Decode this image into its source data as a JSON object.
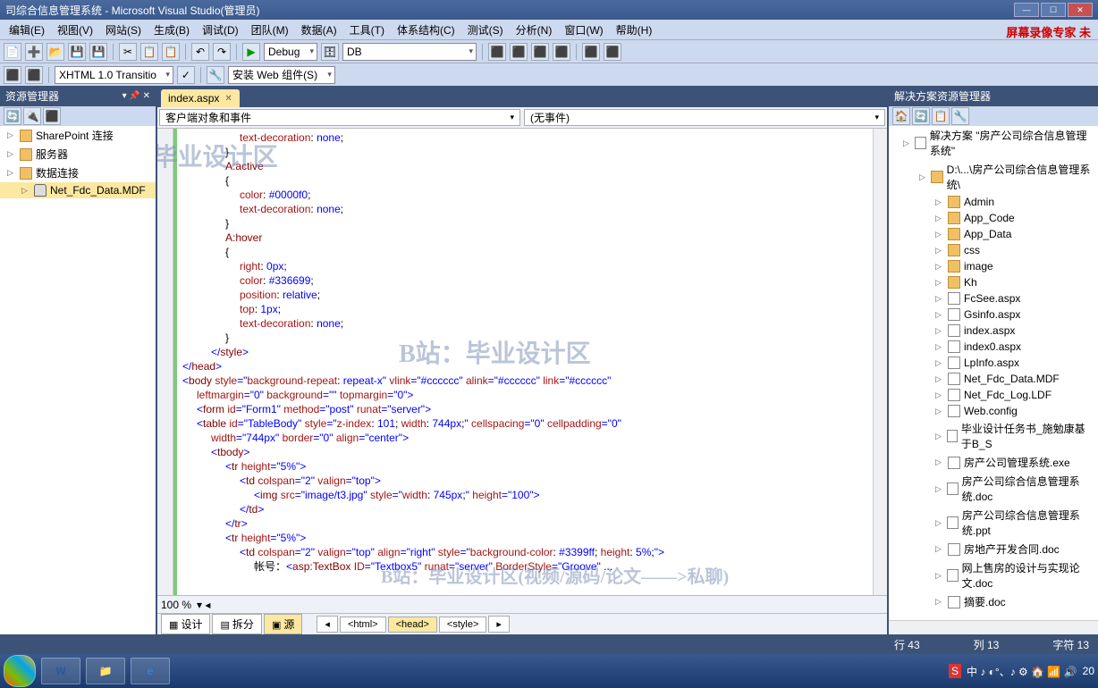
{
  "title": "司综合信息管理系统 - Microsoft Visual Studio(管理员)",
  "watermark_top": "屏幕录像专家 未",
  "menus": [
    "编辑(E)",
    "视图(V)",
    "网站(S)",
    "生成(B)",
    "调试(D)",
    "团队(M)",
    "数据(A)",
    "工具(T)",
    "体系结构(C)",
    "测试(S)",
    "分析(N)",
    "窗口(W)",
    "帮助(H)"
  ],
  "toolbar1": {
    "config": "Debug",
    "db": "DB"
  },
  "toolbar2": {
    "doctype": "XHTML 1.0 Transitio",
    "install": "安装 Web 组件(S)"
  },
  "left_panel": {
    "title": "资源管理器",
    "items": [
      "SharePoint 连接",
      "服务器",
      "数据连接"
    ],
    "child": "Net_Fdc_Data.MDF"
  },
  "tab": "index.aspx",
  "dd_left": "客户端对象和事件",
  "dd_right": "(无事件)",
  "code_lines": [
    {
      "indent": 16,
      "parts": [
        {
          "c": "c-r",
          "t": "text-decoration"
        },
        {
          "t": ": "
        },
        {
          "c": "c-b",
          "t": "none"
        },
        {
          "t": ";"
        }
      ]
    },
    {
      "indent": 12,
      "parts": [
        {
          "t": "}"
        }
      ]
    },
    {
      "indent": 12,
      "parts": [
        {
          "c": "c-m",
          "t": "A:active"
        }
      ]
    },
    {
      "indent": 12,
      "parts": [
        {
          "t": "{"
        }
      ]
    },
    {
      "indent": 16,
      "parts": [
        {
          "c": "c-r",
          "t": "color"
        },
        {
          "t": ": "
        },
        {
          "c": "c-b",
          "t": "#0000f0"
        },
        {
          "t": ";"
        }
      ]
    },
    {
      "indent": 16,
      "parts": [
        {
          "c": "c-r",
          "t": "text-decoration"
        },
        {
          "t": ": "
        },
        {
          "c": "c-b",
          "t": "none"
        },
        {
          "t": ";"
        }
      ]
    },
    {
      "indent": 12,
      "parts": [
        {
          "t": "}"
        }
      ]
    },
    {
      "indent": 12,
      "parts": [
        {
          "c": "c-m",
          "t": "A:hover"
        }
      ]
    },
    {
      "indent": 12,
      "parts": [
        {
          "t": "{"
        }
      ]
    },
    {
      "indent": 16,
      "parts": [
        {
          "c": "c-r",
          "t": "right"
        },
        {
          "t": ": "
        },
        {
          "c": "c-b",
          "t": "0px"
        },
        {
          "t": ";"
        }
      ]
    },
    {
      "indent": 16,
      "parts": [
        {
          "c": "c-r",
          "t": "color"
        },
        {
          "t": ": "
        },
        {
          "c": "c-b",
          "t": "#336699"
        },
        {
          "t": ";"
        }
      ]
    },
    {
      "indent": 16,
      "parts": [
        {
          "c": "c-r",
          "t": "position"
        },
        {
          "t": ": "
        },
        {
          "c": "c-b",
          "t": "relative"
        },
        {
          "t": ";"
        }
      ]
    },
    {
      "indent": 16,
      "parts": [
        {
          "c": "c-r",
          "t": "top"
        },
        {
          "t": ": "
        },
        {
          "c": "c-b",
          "t": "1px"
        },
        {
          "t": ";"
        }
      ]
    },
    {
      "indent": 16,
      "parts": [
        {
          "c": "c-r",
          "t": "text-decoration"
        },
        {
          "t": ": "
        },
        {
          "c": "c-b",
          "t": "none"
        },
        {
          "t": ";"
        }
      ]
    },
    {
      "indent": 12,
      "parts": [
        {
          "t": "}"
        }
      ]
    },
    {
      "indent": 8,
      "parts": [
        {
          "c": "c-b",
          "t": "</"
        },
        {
          "c": "c-m",
          "t": "style"
        },
        {
          "c": "c-b",
          "t": ">"
        }
      ]
    },
    {
      "indent": 0,
      "parts": [
        {
          "c": "c-b",
          "t": "</"
        },
        {
          "c": "c-m",
          "t": "head"
        },
        {
          "c": "c-b",
          "t": ">"
        }
      ]
    },
    {
      "indent": 0,
      "parts": [
        {
          "c": "c-b",
          "t": "<"
        },
        {
          "c": "c-m",
          "t": "body"
        },
        {
          "t": " "
        },
        {
          "c": "c-r",
          "t": "style"
        },
        {
          "c": "c-b",
          "t": "=\""
        },
        {
          "c": "c-r",
          "t": "background-repeat"
        },
        {
          "t": ": "
        },
        {
          "c": "c-b",
          "t": "repeat-x\""
        },
        {
          "t": " "
        },
        {
          "c": "c-r",
          "t": "vlink"
        },
        {
          "c": "c-b",
          "t": "=\"#cccccc\""
        },
        {
          "t": " "
        },
        {
          "c": "c-r",
          "t": "alink"
        },
        {
          "c": "c-b",
          "t": "=\"#cccccc\""
        },
        {
          "t": " "
        },
        {
          "c": "c-r",
          "t": "link"
        },
        {
          "c": "c-b",
          "t": "=\"#cccccc\""
        }
      ]
    },
    {
      "indent": 4,
      "parts": [
        {
          "c": "c-r",
          "t": "leftmargin"
        },
        {
          "c": "c-b",
          "t": "=\"0\""
        },
        {
          "t": " "
        },
        {
          "c": "c-r",
          "t": "background"
        },
        {
          "c": "c-b",
          "t": "=\"\""
        },
        {
          "t": " "
        },
        {
          "c": "c-r",
          "t": "topmargin"
        },
        {
          "c": "c-b",
          "t": "=\"0\">"
        }
      ]
    },
    {
      "indent": 4,
      "parts": [
        {
          "c": "c-b",
          "t": "<"
        },
        {
          "c": "c-m",
          "t": "form"
        },
        {
          "t": " "
        },
        {
          "c": "c-r",
          "t": "id"
        },
        {
          "c": "c-b",
          "t": "=\"Form1\""
        },
        {
          "t": " "
        },
        {
          "c": "c-r",
          "t": "method"
        },
        {
          "c": "c-b",
          "t": "=\"post\""
        },
        {
          "t": " "
        },
        {
          "c": "c-r",
          "t": "runat"
        },
        {
          "c": "c-b",
          "t": "=\"server\">"
        }
      ]
    },
    {
      "indent": 4,
      "parts": [
        {
          "c": "c-b",
          "t": "<"
        },
        {
          "c": "c-m",
          "t": "table"
        },
        {
          "t": " "
        },
        {
          "c": "c-r",
          "t": "id"
        },
        {
          "c": "c-b",
          "t": "=\"TableBody\""
        },
        {
          "t": " "
        },
        {
          "c": "c-r",
          "t": "style"
        },
        {
          "c": "c-b",
          "t": "=\""
        },
        {
          "c": "c-r",
          "t": "z-index"
        },
        {
          "t": ": "
        },
        {
          "c": "c-b",
          "t": "101"
        },
        {
          "t": "; "
        },
        {
          "c": "c-r",
          "t": "width"
        },
        {
          "t": ": "
        },
        {
          "c": "c-b",
          "t": "744px"
        },
        {
          "t": ";"
        },
        {
          "c": "c-b",
          "t": "\""
        },
        {
          "t": " "
        },
        {
          "c": "c-r",
          "t": "cellspacing"
        },
        {
          "c": "c-b",
          "t": "=\"0\""
        },
        {
          "t": " "
        },
        {
          "c": "c-r",
          "t": "cellpadding"
        },
        {
          "c": "c-b",
          "t": "=\"0\""
        }
      ]
    },
    {
      "indent": 8,
      "parts": [
        {
          "c": "c-r",
          "t": "width"
        },
        {
          "c": "c-b",
          "t": "=\"744px\""
        },
        {
          "t": " "
        },
        {
          "c": "c-r",
          "t": "border"
        },
        {
          "c": "c-b",
          "t": "=\"0\""
        },
        {
          "t": " "
        },
        {
          "c": "c-r",
          "t": "align"
        },
        {
          "c": "c-b",
          "t": "=\"center\">"
        }
      ]
    },
    {
      "indent": 8,
      "parts": [
        {
          "c": "c-b",
          "t": "<"
        },
        {
          "c": "c-m",
          "t": "tbody"
        },
        {
          "c": "c-b",
          "t": ">"
        }
      ]
    },
    {
      "indent": 12,
      "parts": [
        {
          "c": "c-b",
          "t": "<"
        },
        {
          "c": "c-m",
          "t": "tr"
        },
        {
          "t": " "
        },
        {
          "c": "c-r",
          "t": "height"
        },
        {
          "c": "c-b",
          "t": "=\"5%\">"
        }
      ]
    },
    {
      "indent": 16,
      "parts": [
        {
          "c": "c-b",
          "t": "<"
        },
        {
          "c": "c-m",
          "t": "td"
        },
        {
          "t": " "
        },
        {
          "c": "c-r",
          "t": "colspan"
        },
        {
          "c": "c-b",
          "t": "=\"2\""
        },
        {
          "t": " "
        },
        {
          "c": "c-r",
          "t": "valign"
        },
        {
          "c": "c-b",
          "t": "=\"top\">"
        }
      ]
    },
    {
      "indent": 20,
      "parts": [
        {
          "c": "c-b",
          "t": "<"
        },
        {
          "c": "c-m",
          "t": "img"
        },
        {
          "t": " "
        },
        {
          "c": "c-r",
          "t": "src"
        },
        {
          "c": "c-b",
          "t": "=\"image/t3.jpg\""
        },
        {
          "t": " "
        },
        {
          "c": "c-r",
          "t": "style"
        },
        {
          "c": "c-b",
          "t": "=\""
        },
        {
          "c": "c-r",
          "t": "width"
        },
        {
          "t": ": "
        },
        {
          "c": "c-b",
          "t": "745px"
        },
        {
          "t": ";"
        },
        {
          "c": "c-b",
          "t": "\""
        },
        {
          "t": " "
        },
        {
          "c": "c-r",
          "t": "height"
        },
        {
          "c": "c-b",
          "t": "=\"100\">"
        }
      ]
    },
    {
      "indent": 16,
      "parts": [
        {
          "c": "c-b",
          "t": "</"
        },
        {
          "c": "c-m",
          "t": "td"
        },
        {
          "c": "c-b",
          "t": ">"
        }
      ]
    },
    {
      "indent": 12,
      "parts": [
        {
          "c": "c-b",
          "t": "</"
        },
        {
          "c": "c-m",
          "t": "tr"
        },
        {
          "c": "c-b",
          "t": ">"
        }
      ]
    },
    {
      "indent": 12,
      "parts": [
        {
          "c": "c-b",
          "t": "<"
        },
        {
          "c": "c-m",
          "t": "tr"
        },
        {
          "t": " "
        },
        {
          "c": "c-r",
          "t": "height"
        },
        {
          "c": "c-b",
          "t": "=\"5%\">"
        }
      ]
    },
    {
      "indent": 16,
      "parts": [
        {
          "c": "c-b",
          "t": "<"
        },
        {
          "c": "c-m",
          "t": "td"
        },
        {
          "t": " "
        },
        {
          "c": "c-r",
          "t": "colspan"
        },
        {
          "c": "c-b",
          "t": "=\"2\""
        },
        {
          "t": " "
        },
        {
          "c": "c-r",
          "t": "valign"
        },
        {
          "c": "c-b",
          "t": "=\"top\""
        },
        {
          "t": " "
        },
        {
          "c": "c-r",
          "t": "align"
        },
        {
          "c": "c-b",
          "t": "=\"right\""
        },
        {
          "t": " "
        },
        {
          "c": "c-r",
          "t": "style"
        },
        {
          "c": "c-b",
          "t": "=\""
        },
        {
          "c": "c-r",
          "t": "background-color"
        },
        {
          "t": ": "
        },
        {
          "c": "c-b",
          "t": "#3399ff"
        },
        {
          "t": "; "
        },
        {
          "c": "c-r",
          "t": "height"
        },
        {
          "t": ": "
        },
        {
          "c": "c-b",
          "t": "5%"
        },
        {
          "t": ";"
        },
        {
          "c": "c-b",
          "t": "\">"
        }
      ]
    },
    {
      "indent": 20,
      "parts": [
        {
          "t": "帐号："
        },
        {
          "c": "c-b",
          "t": "<"
        },
        {
          "c": "c-m",
          "t": "asp:TextBox"
        },
        {
          "t": " "
        },
        {
          "c": "c-r",
          "t": "ID"
        },
        {
          "c": "c-b",
          "t": "=\"Textbox5\""
        },
        {
          "t": " "
        },
        {
          "c": "c-r",
          "t": "runat"
        },
        {
          "c": "c-b",
          "t": "=\"server\""
        },
        {
          "t": " "
        },
        {
          "c": "c-r",
          "t": "BorderStyle"
        },
        {
          "c": "c-b",
          "t": "=\"Groove\""
        },
        {
          "t": " ..."
        }
      ]
    }
  ],
  "wm1": "B站：毕业设计区",
  "wm2": "B站：毕业设计区",
  "wm3": "B站：毕业设计区(视频/源码/论文——>私聊)",
  "zoom": "100 %",
  "view_tabs": [
    "设计",
    "拆分",
    "源"
  ],
  "breadcrumb": [
    "<html>",
    "<head>",
    "<style>"
  ],
  "right_panel": {
    "title": "解决方案资源管理器",
    "solution": "解决方案 \"房产公司综合信息管理系统\"",
    "project": "D:\\...\\房产公司综合信息管理系统\\",
    "folders": [
      "Admin",
      "App_Code",
      "App_Data",
      "css",
      "image",
      "Kh"
    ],
    "files": [
      "FcSee.aspx",
      "Gsinfo.aspx",
      "index.aspx",
      "index0.aspx",
      "LpInfo.aspx",
      "Net_Fdc_Data.MDF",
      "Net_Fdc_Log.LDF",
      "Web.config",
      "毕业设计任务书_施勉康基于B_S",
      "房产公司管理系统.exe",
      "房产公司综合信息管理系统.doc",
      "房产公司综合信息管理系统.ppt",
      "房地产开发合同.doc",
      "网上售房的设计与实现论文.doc",
      "摘要.doc"
    ]
  },
  "status": {
    "line": "行 43",
    "col": "列 13",
    "char": "字符 13"
  },
  "tray": "中 ♪ ◐°、♪ ⚙ 🏠 📶 🔊"
}
